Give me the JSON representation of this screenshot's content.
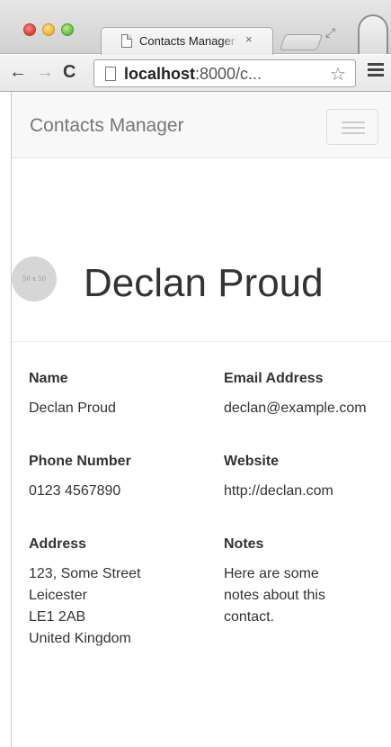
{
  "browser": {
    "tab_title": "Contacts Manager",
    "tab_close": "×",
    "url_host": "localhost",
    "url_rest": ":8000/c...",
    "back_icon": "←",
    "forward_icon": "→",
    "reload_icon": "C",
    "star_icon": "☆",
    "expand_icon": "⤢"
  },
  "navbar": {
    "brand": "Contacts Manager"
  },
  "contact": {
    "avatar_placeholder": "50 x 50",
    "name": "Declan Proud"
  },
  "fields": {
    "name_label": "Name",
    "name_value": "Declan Proud",
    "email_label": "Email Address",
    "email_value": "declan@example.com",
    "phone_label": "Phone Number",
    "phone_value": "0123 4567890",
    "website_label": "Website",
    "website_value": "http://declan.com",
    "address_label": "Address",
    "address_value": "123, Some Street\nLeicester\nLE1 2AB\nUnited Kingdom",
    "notes_label": "Notes",
    "notes_value": "Here are some\nnotes about this\ncontact."
  }
}
